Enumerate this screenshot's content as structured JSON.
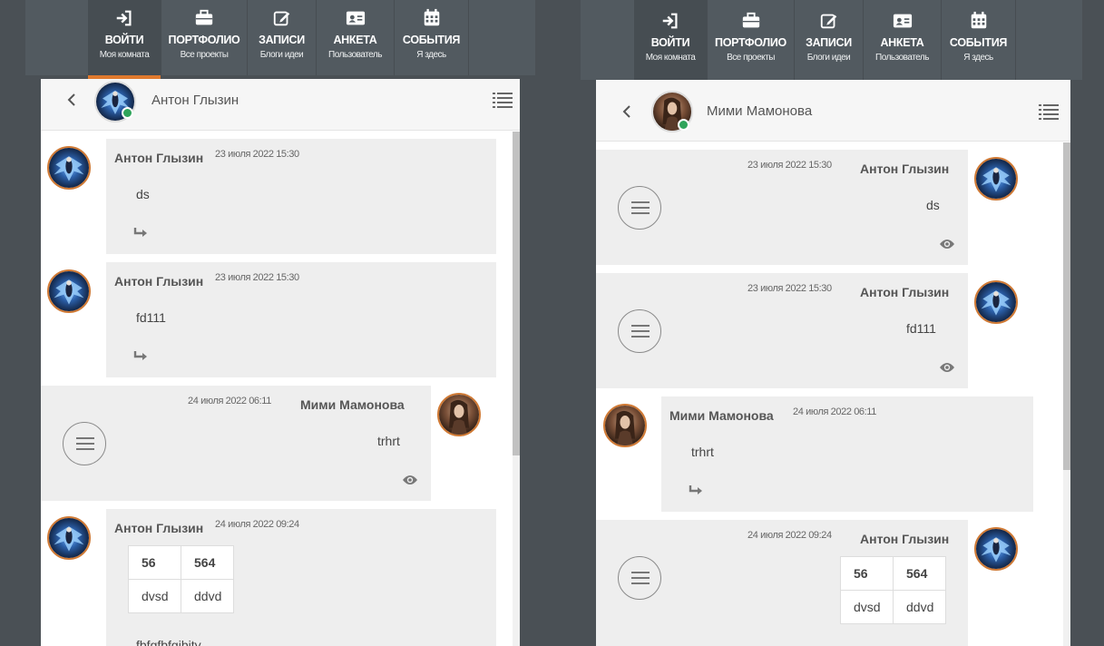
{
  "nav": {
    "items": [
      {
        "title": "ВОЙТИ",
        "sub": "Моя комната",
        "icon": "sign-in-icon",
        "active": true
      },
      {
        "title": "ПОРТФОЛИО",
        "sub": "Все проекты",
        "icon": "briefcase-icon"
      },
      {
        "title": "ЗАПИСИ",
        "sub": "Блоги идеи",
        "icon": "edit-icon"
      },
      {
        "title": "АНКЕТА",
        "sub": "Пользователь",
        "icon": "id-card-icon"
      },
      {
        "title": "СОБЫТИЯ",
        "sub": "Я здесь",
        "icon": "calendar-icon"
      }
    ]
  },
  "left": {
    "header_name": "Антон Глызин",
    "messages": [
      {
        "author": "Антон Глызин",
        "date": "23 июля 2022 15:30",
        "text": "ds"
      },
      {
        "author": "Антон Глызин",
        "date": "23 июля 2022 15:30",
        "text": "fd111"
      },
      {
        "author": "Мими Мамонова",
        "date": "24 июля 2022 06:11",
        "text": "trhrt"
      },
      {
        "author": "Антон Глызин",
        "date": "24 июля 2022 09:24",
        "text": "fbfgfbfgjbjty",
        "table": [
          [
            "56",
            "564"
          ],
          [
            "dvsd",
            "ddvd"
          ]
        ]
      }
    ]
  },
  "right": {
    "header_name": "Мими Мамонова",
    "messages": [
      {
        "author": "Антон Глызин",
        "date": "23 июля 2022 15:30",
        "text": "ds"
      },
      {
        "author": "Антон Глызин",
        "date": "23 июля 2022 15:30",
        "text": "fd111"
      },
      {
        "author": "Мими Мамонова",
        "date": "24 июля 2022 06:11",
        "text": "trhrt"
      },
      {
        "author": "Антон Глызин",
        "date": "24 июля 2022 09:24",
        "table": [
          [
            "56",
            "564"
          ],
          [
            "dvsd",
            "ddvd"
          ]
        ]
      }
    ]
  },
  "colors": {
    "accent": "#e07a2e",
    "online": "#2fa45a",
    "navbar": "#525a60"
  }
}
